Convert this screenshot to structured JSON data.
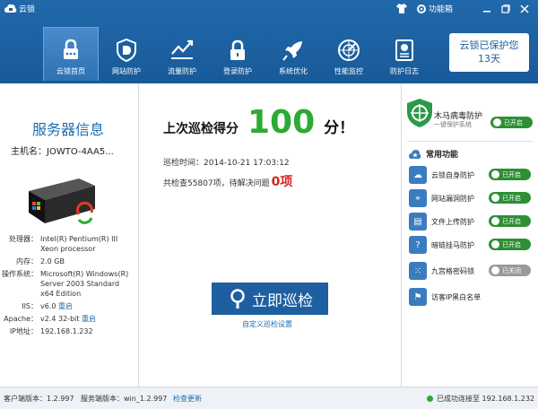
{
  "app": {
    "title": "云锁",
    "toolbox_label": "功能箱"
  },
  "nav": [
    {
      "label": "云锁首页",
      "icon": "lock-home-icon"
    },
    {
      "label": "网站防护",
      "icon": "web-shield-icon"
    },
    {
      "label": "流量防护",
      "icon": "traffic-icon"
    },
    {
      "label": "登录防护",
      "icon": "padlock-icon"
    },
    {
      "label": "系统优化",
      "icon": "rocket-icon"
    },
    {
      "label": "性能监控",
      "icon": "radar-icon"
    },
    {
      "label": "防护日志",
      "icon": "log-icon"
    }
  ],
  "badge": {
    "line1": "云锁已保护您",
    "line2": "13天"
  },
  "server": {
    "title": "服务器信息",
    "hostname": "主机名：JOWTO-4AA5...",
    "info": [
      {
        "key": "处理器：",
        "value": "Intel(R) Pentium(R) III Xeon processor"
      },
      {
        "key": "内存：",
        "value": "2.0 GB"
      },
      {
        "key": "操作系统：",
        "value": "Microsoft(R) Windows(R) Server 2003 Standard x64 Edition"
      },
      {
        "key": "IIS：",
        "value": "v6.0",
        "link": "重启"
      },
      {
        "key": "Apache：",
        "value": "v2.4 32-bit",
        "link": "重启"
      },
      {
        "key": "IP地址：",
        "value": "192.168.1.232"
      }
    ]
  },
  "scan": {
    "score_label": "上次巡检得分",
    "score": "100",
    "score_unit": "分！",
    "time": "巡检时间：2014-10-21 17:03:12",
    "summary": "共检查55807项，待解决问题",
    "issues": "0项",
    "button": "立即巡检",
    "custom_link": "自定义巡检设置"
  },
  "trojan": {
    "title": "木马病毒防护",
    "subtitle": "一键保护系统",
    "toggle": "已开启"
  },
  "common": {
    "title": "常用功能",
    "items": [
      {
        "label": "云锁自身防护",
        "toggle": "已开启",
        "on": true
      },
      {
        "label": "网站漏洞防护",
        "toggle": "已开启",
        "on": true
      },
      {
        "label": "文件上传防护",
        "toggle": "已开启",
        "on": true
      },
      {
        "label": "暗链挂马防护",
        "toggle": "已开启",
        "on": true
      },
      {
        "label": "九宫格密码锁",
        "toggle": "已关闭",
        "on": false
      },
      {
        "label": "访客IP黑白名单",
        "toggle": "",
        "on": null
      }
    ]
  },
  "status": {
    "client": "客户端版本：1.2.997",
    "server": "服务端版本：win_1.2.997",
    "update": "检查更新",
    "connected": "已成功连接至 192.168.1.232"
  },
  "colors": {
    "header": "#1c5e9e",
    "accent": "#1d6db0",
    "green": "#2bab32",
    "red": "#d32222"
  }
}
